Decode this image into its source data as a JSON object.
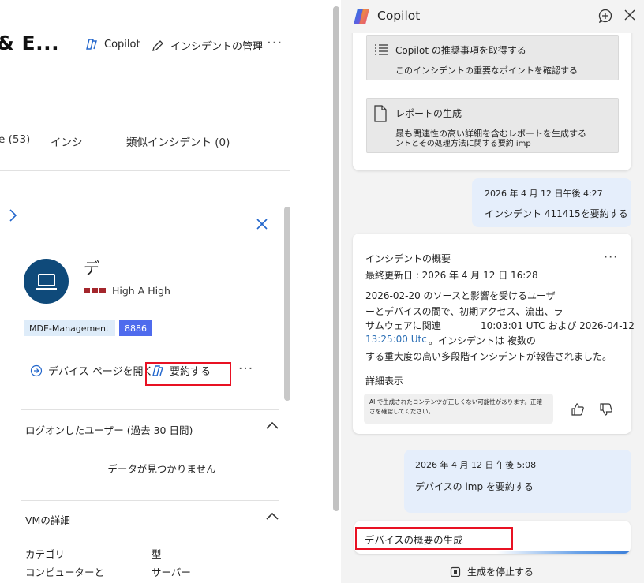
{
  "left": {
    "title": "& E...",
    "header": {
      "copilot_label": "Copilot",
      "manage_label": "インシデントの管理",
      "more": "···"
    },
    "tabs": {
      "tab1": "e (53)",
      "tab2": "インシ",
      "tab3": "類似インシデント (0)"
    },
    "device": {
      "name": "デ",
      "severity_label": "High A High",
      "tags": [
        "MDE-Management",
        "8886"
      ],
      "open_page_label": "デバイス ページを開く",
      "summarize_label": "要約する",
      "more": "···"
    },
    "logged_users": {
      "title": "ログオンしたユーザー (過去 30 日間)",
      "empty_text": "データが見つかりません"
    },
    "vm": {
      "title": "VMの詳細",
      "category_label": "カテゴリ",
      "category_value": "コンピューターと",
      "type_label": "型",
      "type_value": "サーバー"
    }
  },
  "copilot": {
    "title": "Copilot",
    "suggestions": [
      {
        "title": "Copilot の推奨事項を取得する",
        "desc": "このインシデントの重要なポイントを確認する"
      },
      {
        "title": "レポートの生成",
        "desc1": "最も関連性の高い詳細を含むレポートを生成する",
        "desc2": "ントとその処理方法に関する要約 imp"
      }
    ],
    "user_msg1": {
      "time": "2026 年 4 月 12 日午後 4:27",
      "text": "インシデント 411415を要約する"
    },
    "response": {
      "title": "インシデントの概要",
      "updated": "最終更新日 : 2026 年 4 月 12 日 16:28",
      "line1": "2026-02-20 のソースと影響を受けるユーザ",
      "line2": "ーとデバイスの間で、初期アクセス、流出、ラ",
      "line3a": "サムウェアに関連",
      "line3b": "10:03:01 UTC および 2026-04-12",
      "line4a": "13:25:00 Utc",
      "line4b": "。インシデントは 複数の",
      "line5": "する重大度の高い多段階インシデントが報告されました。",
      "show_more": "詳細表示",
      "ai_note": "AI で生成されたコンテンツが正しくない可能性があります。正確さを確認してください。",
      "more": "···"
    },
    "user_msg2": {
      "time": "2026 年 4 月 12 日 午後 5:08",
      "text": "デバイスの imp を要約する"
    },
    "input_text": "デバイスの概要の生成",
    "stop_label": "生成を停止する"
  },
  "colors": {
    "accent_red": "#e81123",
    "severity": "#a4262c",
    "avatar": "#0f4a7a",
    "user_bubble": "#e5eefb",
    "tag_blue": "#4f6bed"
  }
}
